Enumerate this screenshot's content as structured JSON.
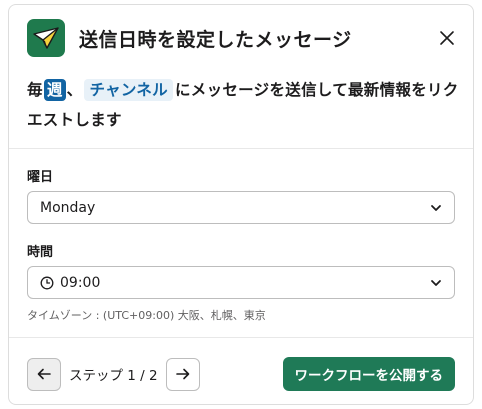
{
  "modal": {
    "title": "送信日時を設定したメッセージ",
    "icon": "paper-plane-icon",
    "close_icon": "close-icon"
  },
  "description": {
    "part1": "毎",
    "week_badge": "週",
    "part2": "、",
    "channel": "チャンネル",
    "part3": "にメッセージを送信して最新情報をリクエストします"
  },
  "day_field": {
    "label": "曜日",
    "selected": "Monday"
  },
  "time_field": {
    "label": "時間",
    "selected": "09:00",
    "timezone_hint": "タイムゾーン : (UTC+09:00) 大阪、札幌、東京"
  },
  "footer": {
    "step_text": "ステップ 1 / 2",
    "publish_label": "ワークフローを公開する"
  },
  "colors": {
    "brand_green": "#1f7a57",
    "link_blue": "#1264a3",
    "channel_bg": "#e8f1f8"
  }
}
